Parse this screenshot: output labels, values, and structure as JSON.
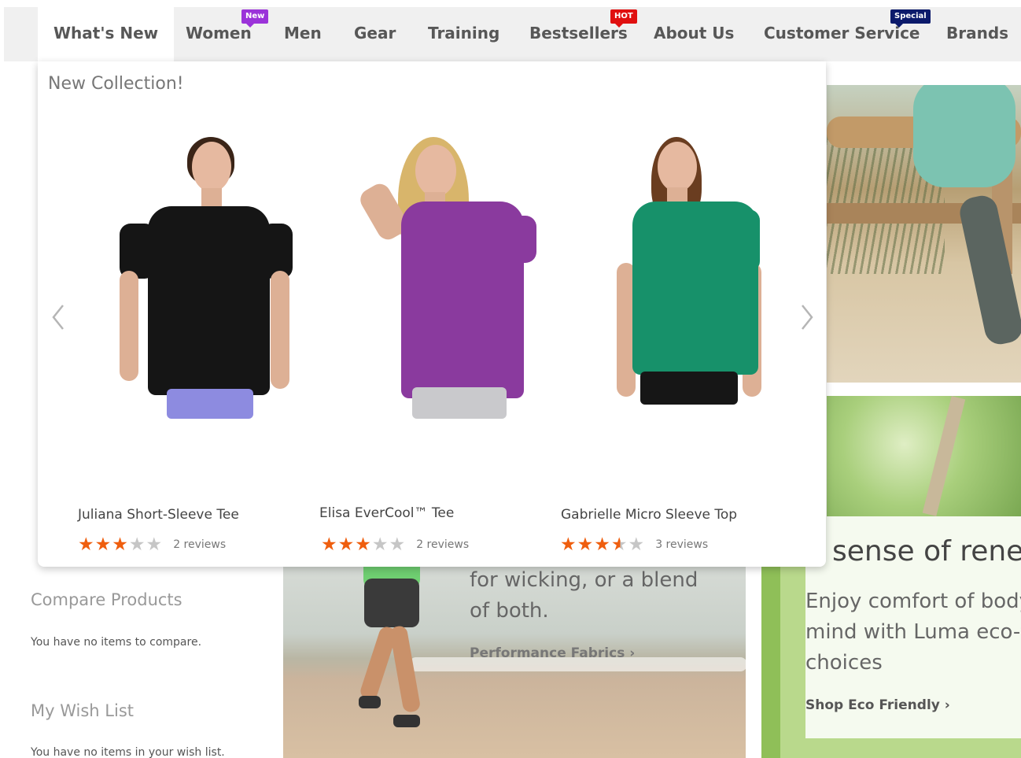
{
  "nav": {
    "items": [
      {
        "label": "What's New"
      },
      {
        "label": "Women",
        "badge": "New"
      },
      {
        "label": "Men"
      },
      {
        "label": "Gear"
      },
      {
        "label": "Training"
      },
      {
        "label": "Bestsellers",
        "badge": "HOT"
      },
      {
        "label": "About Us"
      },
      {
        "label": "Customer Service",
        "badge": "Special"
      },
      {
        "label": "Brands"
      }
    ]
  },
  "dropdown": {
    "title": "New Collection!",
    "prev_icon": "chevron-left-icon",
    "next_icon": "chevron-right-icon",
    "products": [
      {
        "name": "Juliana Short-Sleeve Tee",
        "rating_stars": 3,
        "reviews": "2 reviews",
        "shirt_color": "#151515"
      },
      {
        "name": "Elisa EverCool™ Tee",
        "rating_stars": 3,
        "reviews": "2 reviews",
        "shirt_color": "#8a3a9e"
      },
      {
        "name": "Gabrielle Micro Sleeve Top",
        "rating_stars": 3.5,
        "reviews": "3 reviews",
        "shirt_color": "#17916a"
      }
    ]
  },
  "sidebar": {
    "compare_title": "Compare Products",
    "compare_text": "You have no items to compare.",
    "wishlist_title": "My Wish List",
    "wishlist_text": "You have no items in your wish list."
  },
  "promo_performance": {
    "text_lines": [
      "for wicking, or a blend",
      "of both."
    ],
    "link": "Performance Fabrics  ›"
  },
  "promo_eco": {
    "title": "sense of rene",
    "text_lines": [
      "Enjoy comfort of body",
      "mind with Luma eco-fr",
      "choices"
    ],
    "link": "Shop Eco Friendly  ›"
  },
  "colors": {
    "star": "#ef5e0e",
    "badge_new": "#9b33d9",
    "badge_hot": "#e01010",
    "badge_special": "#0c1a6b"
  }
}
